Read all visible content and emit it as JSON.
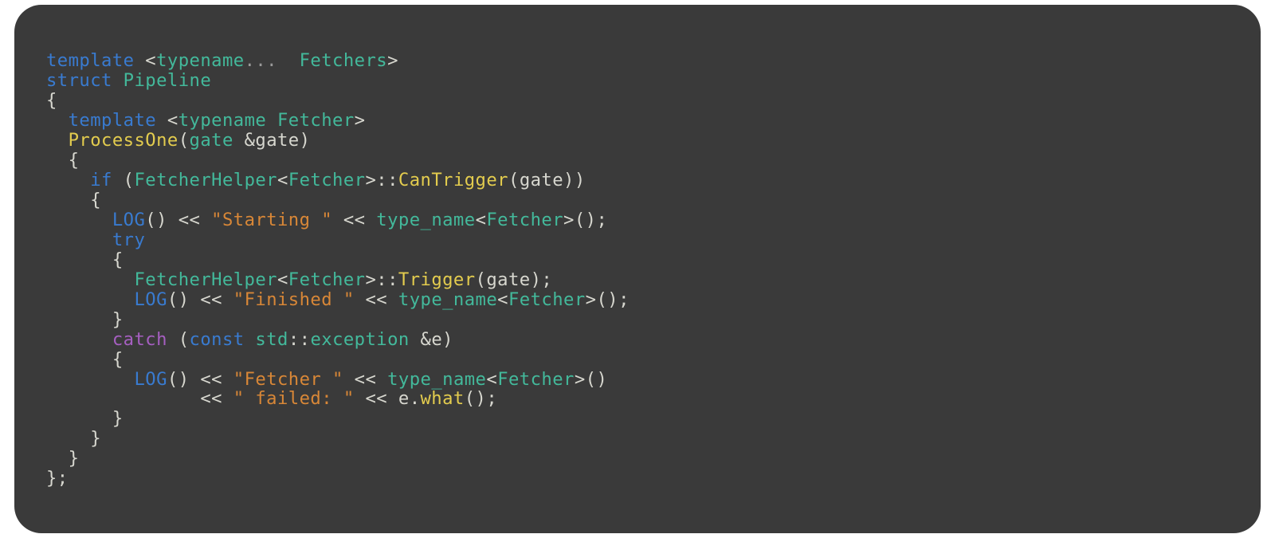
{
  "code": {
    "l1": {
      "kw_template": "template",
      "lt": "<",
      "tn_typename": "typename",
      "dots": "...",
      "sp": "  ",
      "tn_fetchers": "Fetchers",
      "gt": ">"
    },
    "l2": {
      "kw_struct": "struct",
      "tn_pipeline": "Pipeline"
    },
    "l3": {
      "brace": "{"
    },
    "l4": {
      "indent": "  ",
      "kw_template": "template",
      "lt": "<",
      "tn_typename": "typename",
      "tn_fetcher": "Fetcher",
      "gt": ">"
    },
    "l5": {
      "indent": "  ",
      "fn_process": "ProcessOne",
      "lp": "(",
      "tn_gate": "gate",
      "amp_gate": "&gate",
      "rp": ")"
    },
    "l6": {
      "indent": "  ",
      "brace": "{"
    },
    "l7": {
      "indent": "    ",
      "kw_if": "if",
      "lp": "(",
      "tn_fh": "FetcherHelper",
      "lt": "<",
      "tn_f": "Fetcher",
      "gt": ">",
      "co": "::",
      "fn_can": "CanTrigger",
      "lp2": "(",
      "arg": "gate",
      "rp2": ")",
      "rp": ")"
    },
    "l8": {
      "indent": "    ",
      "brace": "{"
    },
    "l9": {
      "indent": "      ",
      "log": "LOG",
      "call": "()",
      "sh1": " << ",
      "str": "\"Starting \"",
      "sh2": " << ",
      "tn_type": "type_name",
      "lt": "<",
      "tn_f": "Fetcher",
      "gt": ">",
      "call2": "();"
    },
    "l10": {
      "indent": "      ",
      "kw_try": "try"
    },
    "l11": {
      "indent": "      ",
      "brace": "{"
    },
    "l12": {
      "indent": "        ",
      "tn_fh": "FetcherHelper",
      "lt": "<",
      "tn_f": "Fetcher",
      "gt": ">",
      "co": "::",
      "fn_trig": "Trigger",
      "call": "(gate);"
    },
    "l13": {
      "indent": "        ",
      "log": "LOG",
      "call": "()",
      "sh1": " << ",
      "str": "\"Finished \"",
      "sh2": " << ",
      "tn_type": "type_name",
      "lt": "<",
      "tn_f": "Fetcher",
      "gt": ">",
      "call2": "();"
    },
    "l14": {
      "indent": "      ",
      "brace": "}"
    },
    "l15": {
      "indent": "      ",
      "kw_catch": "catch",
      "sp": " ",
      "lp": "(",
      "kw_const": "const",
      "sp2": " ",
      "tn_std": "std",
      "co": "::",
      "tn_exc": "exception",
      "amp_e": " &e",
      "rp": ")"
    },
    "l16": {
      "indent": "      ",
      "brace": "{"
    },
    "l17": {
      "indent": "        ",
      "log": "LOG",
      "call": "()",
      "sh1": " << ",
      "str": "\"Fetcher \"",
      "sh2": " << ",
      "tn_type": "type_name",
      "lt": "<",
      "tn_f": "Fetcher",
      "gt": ">",
      "call2": "()"
    },
    "l18": {
      "indent": "              ",
      "sh1": "<< ",
      "str": "\" failed: \"",
      "sh2": " << ",
      "e": "e",
      "dot": ".",
      "fn_what": "what",
      "call": "();"
    },
    "l19": {
      "indent": "      ",
      "brace": "}"
    },
    "l20": {
      "indent": "    ",
      "brace": "}"
    },
    "l21": {
      "indent": "  ",
      "brace": "}"
    },
    "l22": {
      "close": "};"
    }
  }
}
